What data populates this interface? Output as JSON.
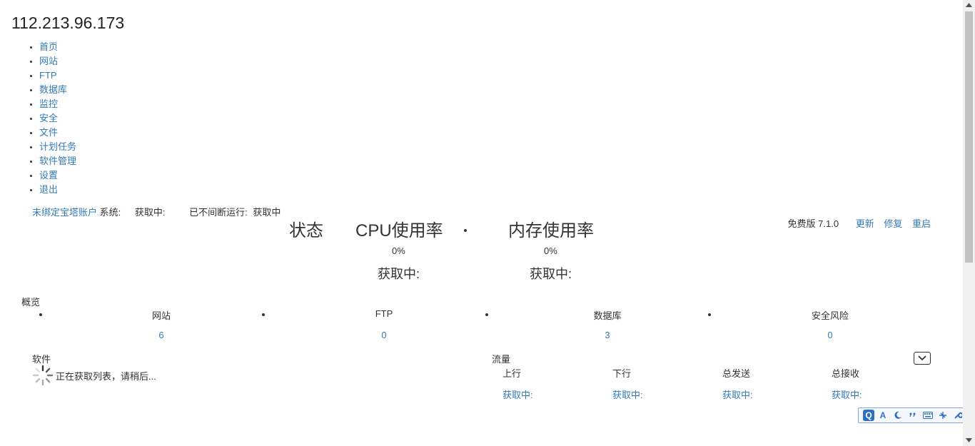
{
  "site": {
    "title": "112.213.96.173"
  },
  "nav": [
    "首页",
    "网站",
    "FTP",
    "数据库",
    "监控",
    "安全",
    "文件",
    "计划任务",
    "软件管理",
    "设置",
    "退出"
  ],
  "account": {
    "bind_link": "未绑定宝塔账户",
    "system_label": "系统:",
    "system_value": "获取中:",
    "uptime_label": "已不间断运行:",
    "uptime_value": "获取中"
  },
  "version": {
    "text": "免费版 7.1.0",
    "update": "更新",
    "repair": "修复",
    "restart": "重启"
  },
  "status": {
    "title": "状态",
    "cpu": {
      "title": "CPU使用率",
      "percent": "0%",
      "detail": "获取中:"
    },
    "memory": {
      "title": "内存使用率",
      "percent": "0%",
      "detail": "获取中:"
    }
  },
  "overview": {
    "title": "概览",
    "items": [
      {
        "label": "网站",
        "value": "6"
      },
      {
        "label": "FTP",
        "value": "0"
      },
      {
        "label": "数据库",
        "value": "3"
      },
      {
        "label": "安全风险",
        "value": "0"
      }
    ]
  },
  "software": {
    "title": "软件",
    "loading": "正在获取列表，请稍后..."
  },
  "traffic": {
    "title": "流量",
    "columns": [
      {
        "label": "上行",
        "value": "获取中:"
      },
      {
        "label": "下行",
        "value": "获取中:"
      },
      {
        "label": "总发送",
        "value": "获取中:"
      },
      {
        "label": "总接收",
        "value": "获取中:"
      }
    ]
  },
  "ime_toolbar": {
    "mode_label": "A",
    "icons": [
      "sogou-q-icon",
      "font-icon",
      "moon-icon",
      "punctuation-icon",
      "keyboard-icon",
      "tools-icon",
      "wrench-icon"
    ]
  },
  "colors": {
    "link": "#337ab7",
    "text": "#333333"
  }
}
